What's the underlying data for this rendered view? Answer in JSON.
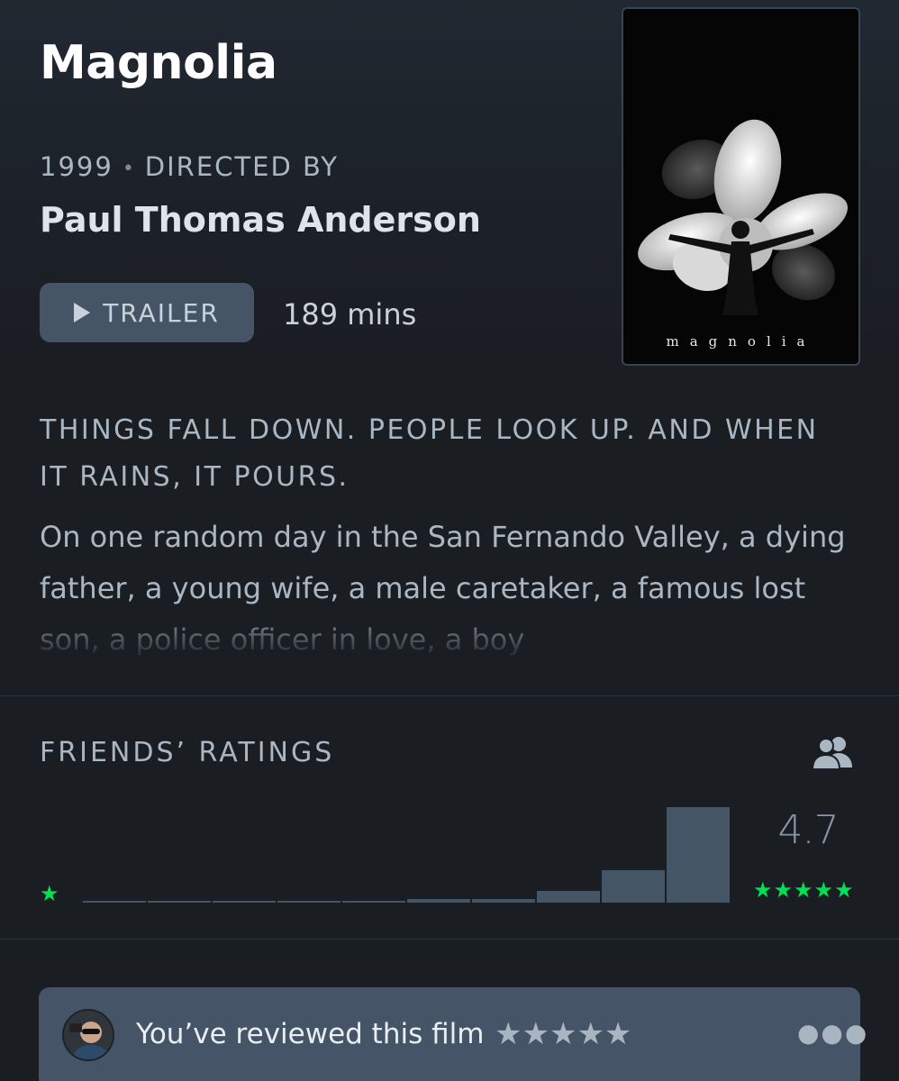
{
  "film": {
    "title": "Magnolia",
    "year": "1999",
    "directed_by_label": "DIRECTED BY",
    "director": "Paul Thomas Anderson",
    "trailer_label": "TRAILER",
    "runtime": "189 mins",
    "poster_caption": "magnolia",
    "tagline": "THINGS FALL DOWN. PEOPLE LOOK UP. AND WHEN IT RAINS, IT POURS.",
    "synopsis": "On one random day in the San Fernando Valley, a dying father, a young wife, a male caretaker, a famous lost son, a police officer in love, a boy"
  },
  "ratings": {
    "label": "FRIENDS’ RATINGS",
    "average": "4.7",
    "min_stars": "★",
    "max_stars": "★★★★★",
    "histogram": [
      0.02,
      0.02,
      0.02,
      0.02,
      0.02,
      0.04,
      0.04,
      0.12,
      0.33,
      0.98
    ],
    "accent_color": "#00e054",
    "bar_color": "#445566",
    "friends_icon": "friends-icon"
  },
  "review": {
    "text": "You’ve reviewed this film",
    "stars": "★★★★★",
    "more_icon": "more-icon"
  }
}
